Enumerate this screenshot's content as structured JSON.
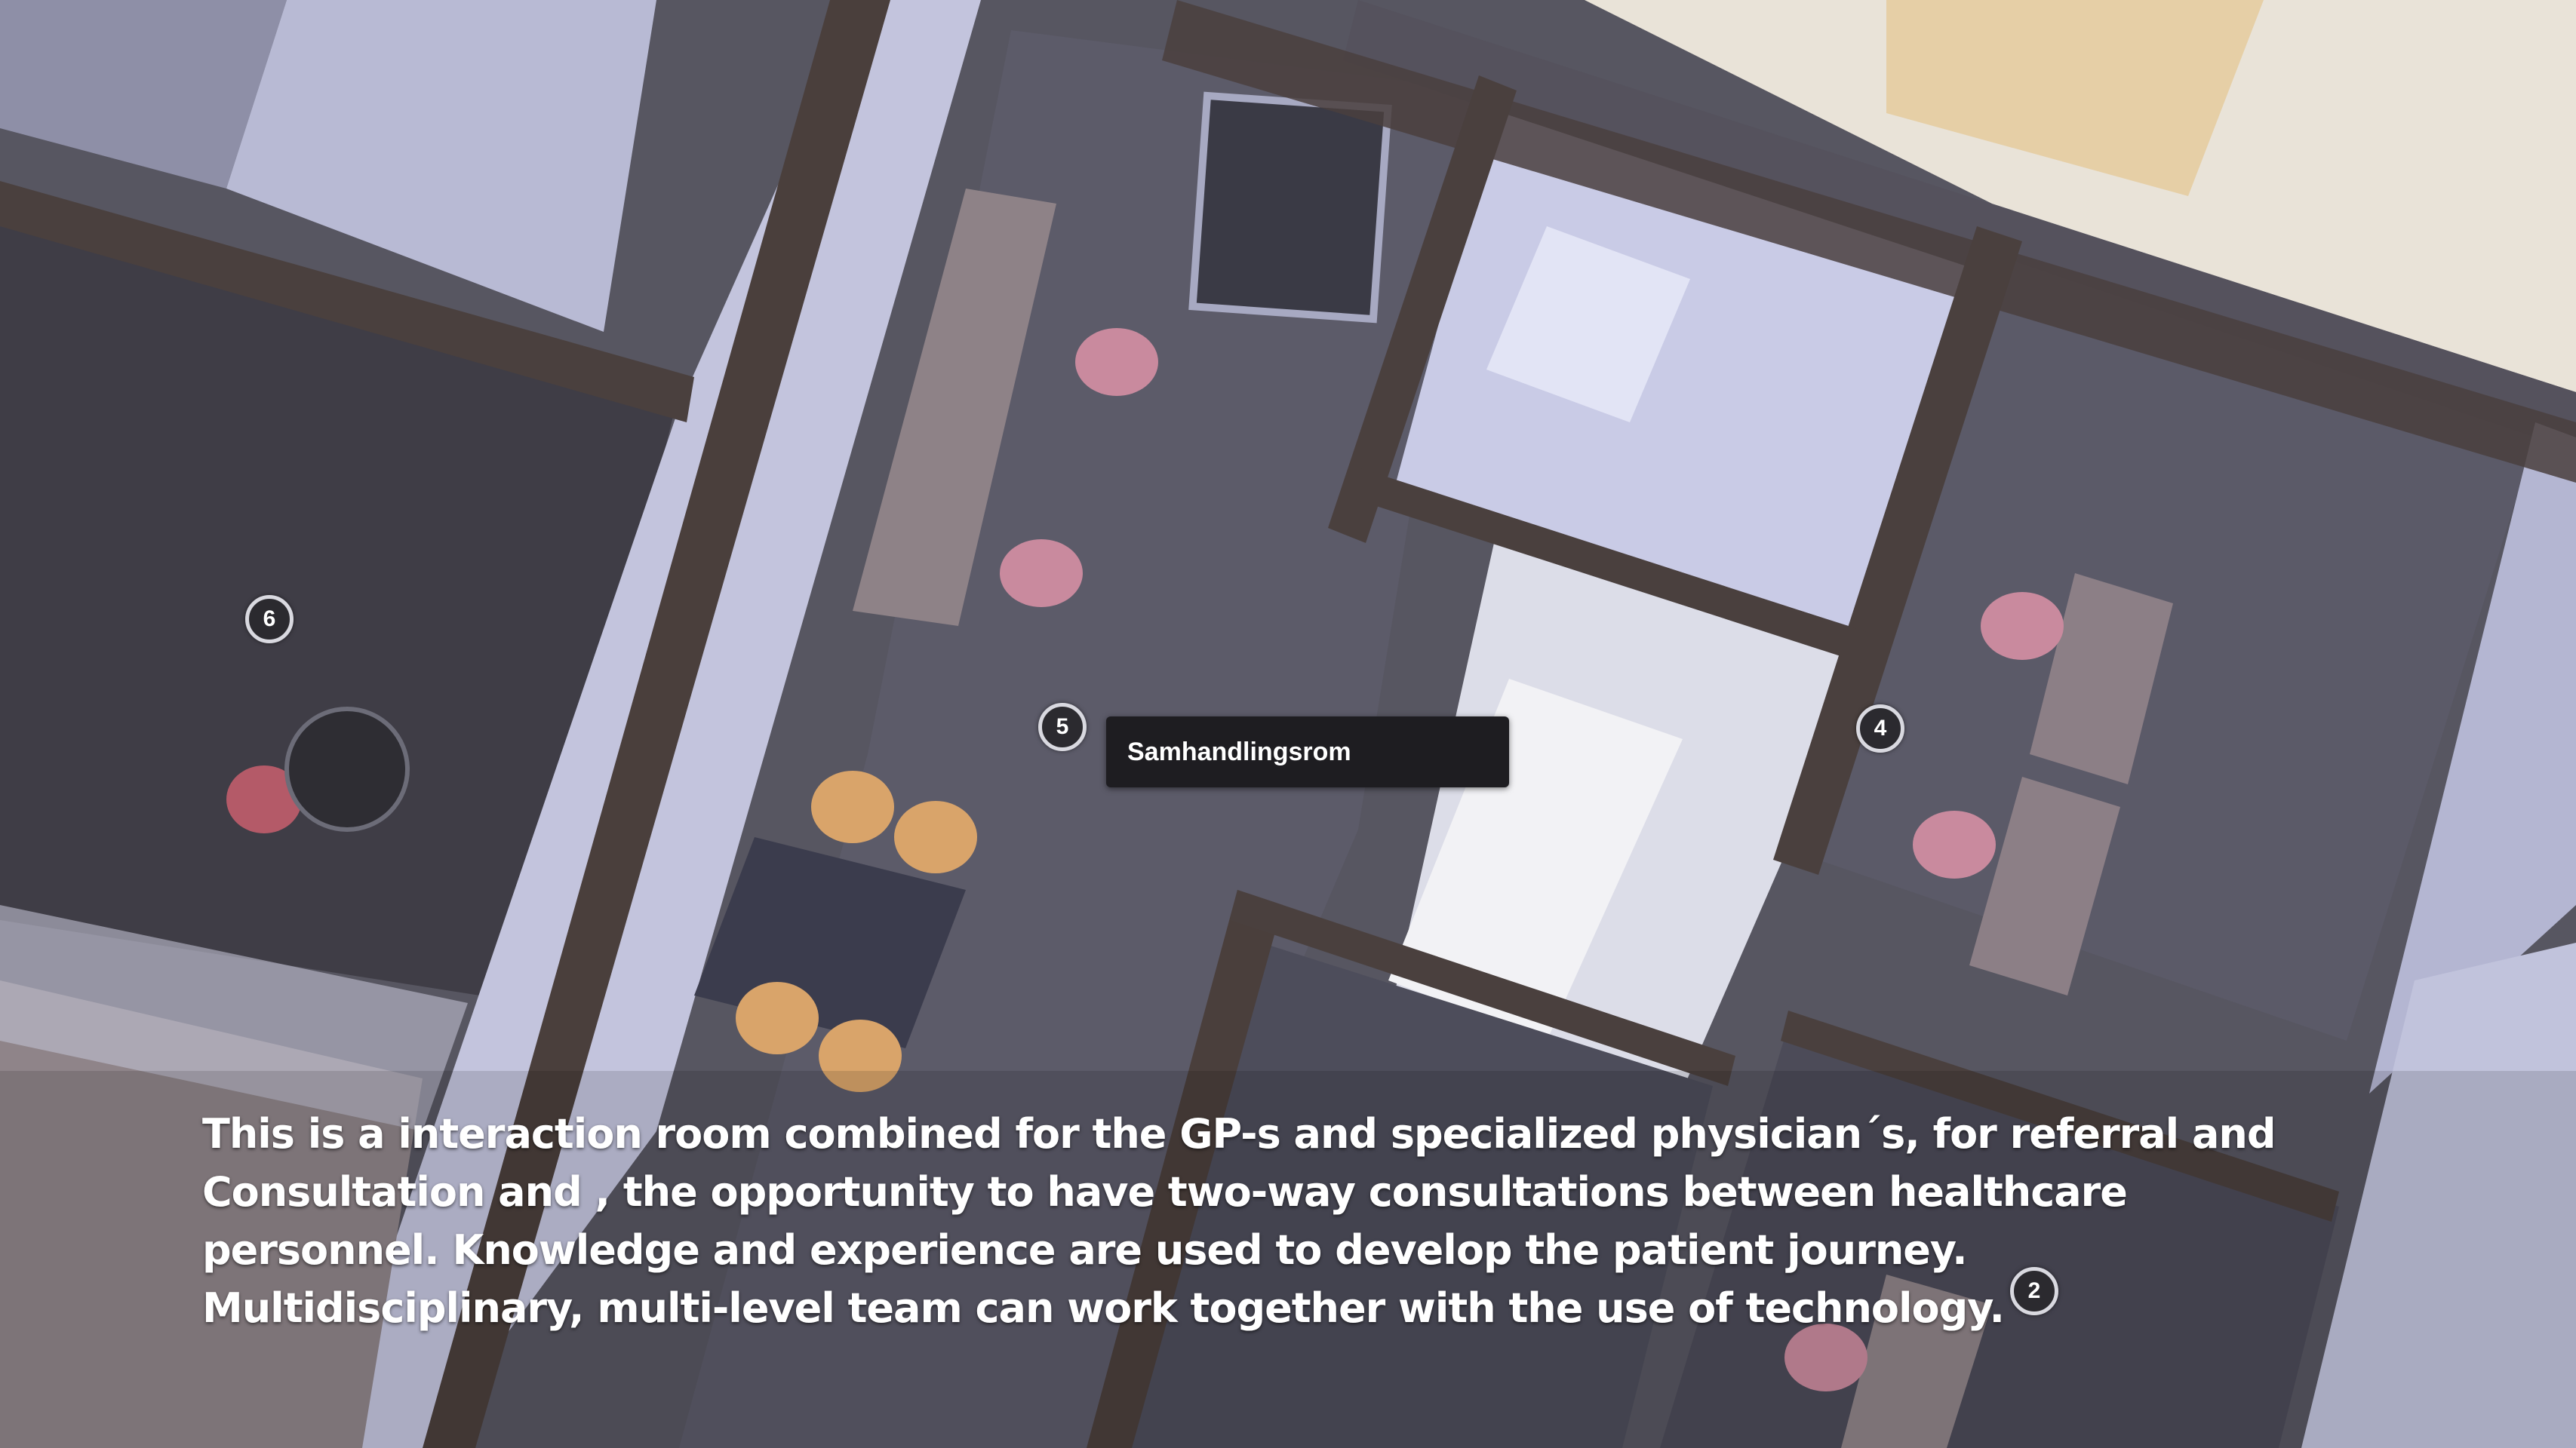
{
  "markers": {
    "m6": "6",
    "m5": "5",
    "m4": "4",
    "m2": "2"
  },
  "tooltip": {
    "label": "Samhandlingsrom"
  },
  "caption": {
    "lines": [
      "This is a interaction room combined for the GP-s and specialized physician´s, for referral and",
      "Consultation and , the opportunity to have two-way consultations between healthcare",
      "personnel. Knowledge and experience are used to develop the patient journey.",
      "Multidisciplinary, multi-level team can work together with the use of technology."
    ]
  },
  "colors": {
    "floor": "#55545f",
    "wall_light": "#b4b6d2",
    "wall_dark": "#4a403e",
    "chair_pink": "#c98a9e",
    "chair_wood": "#d9a46a",
    "tooltip_bg": "#1e1d21"
  }
}
